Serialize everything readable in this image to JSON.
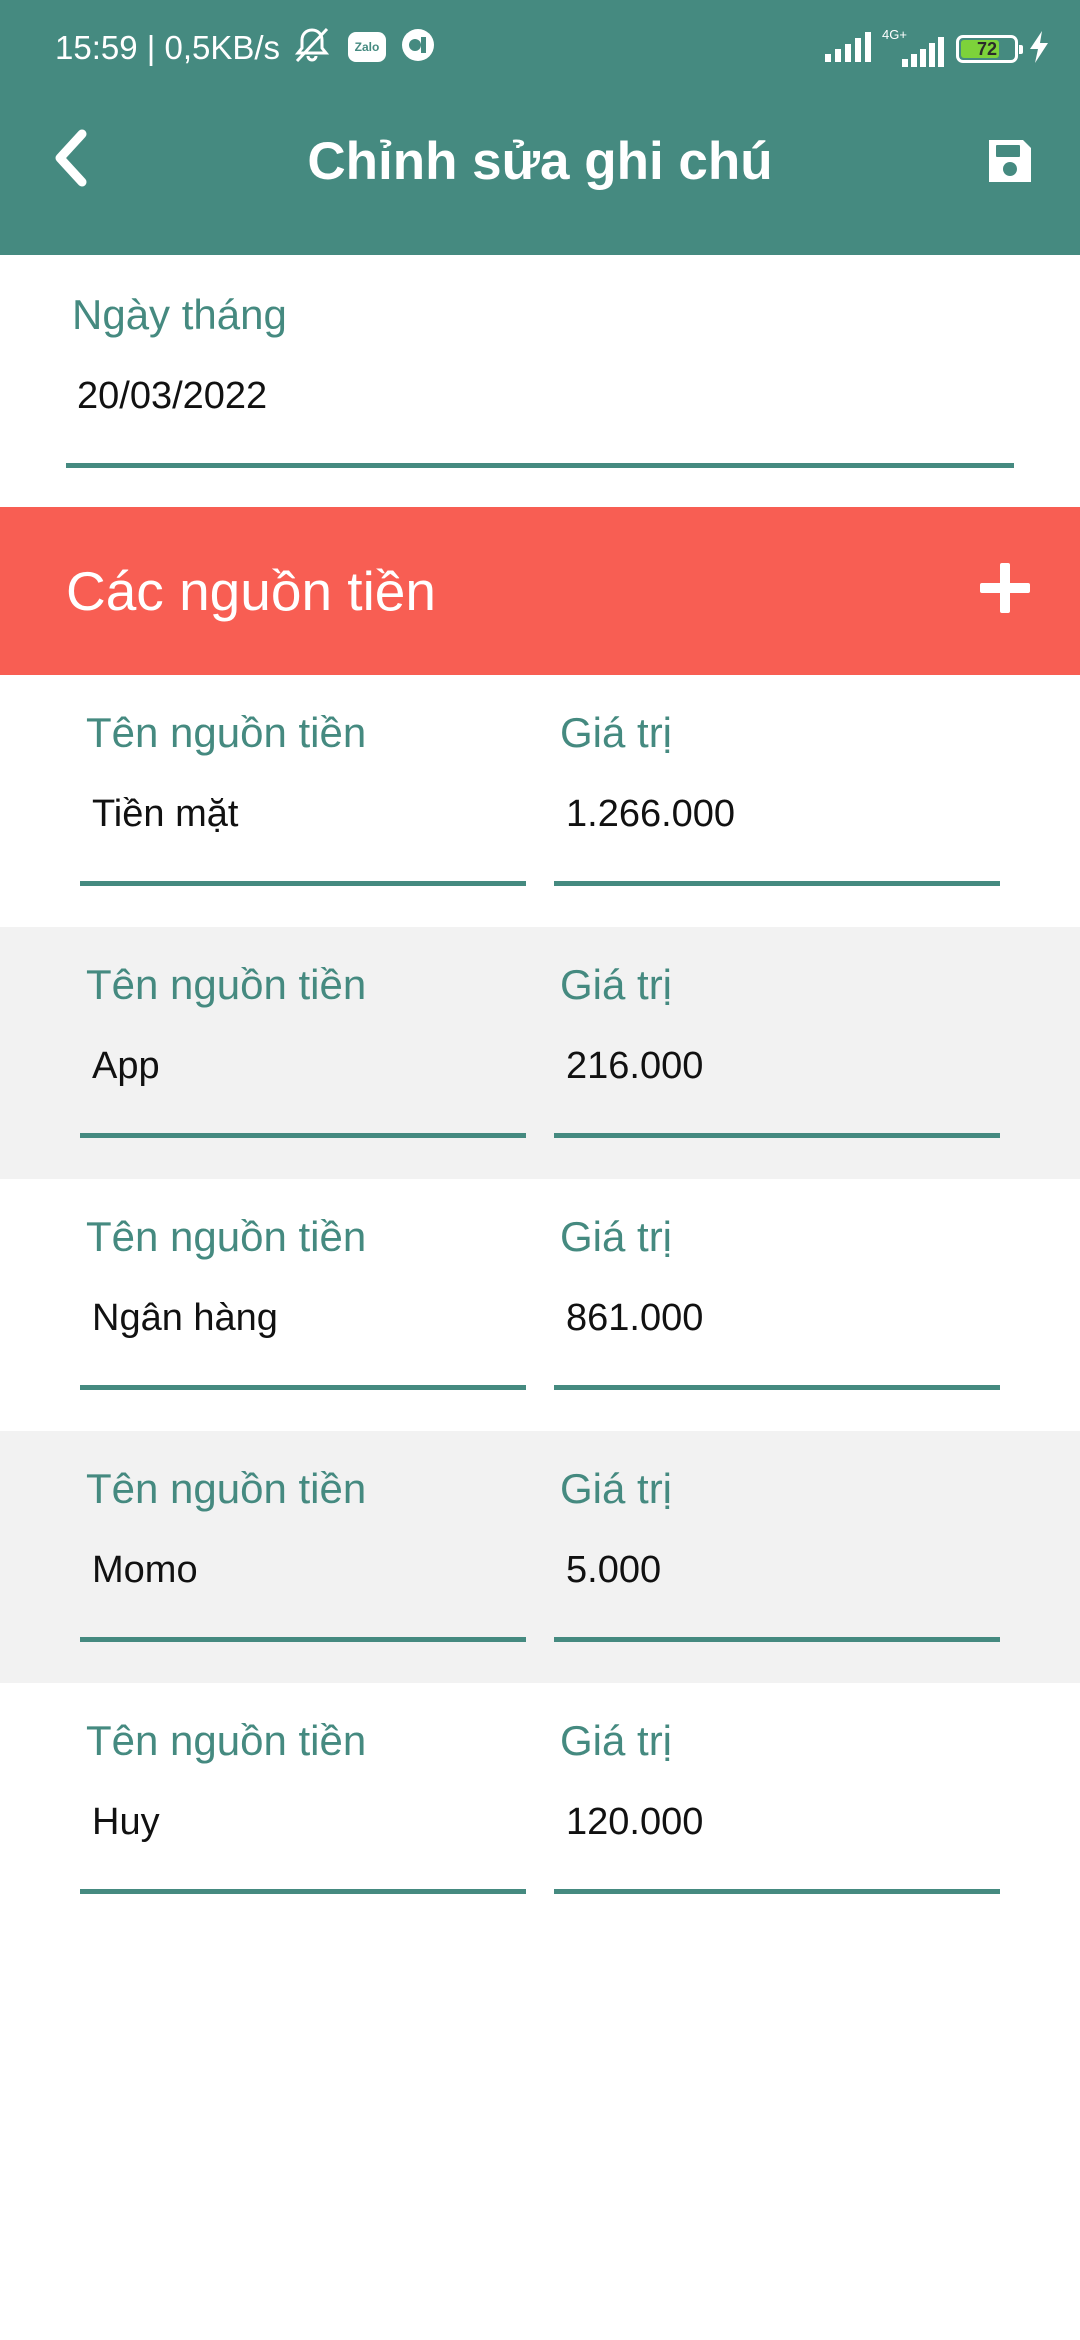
{
  "status_bar": {
    "time_speed": "15:59 | 0,5KB/s",
    "zalo": "Zalo",
    "network": "4G+",
    "battery": "72"
  },
  "app_bar": {
    "title": "Chỉnh sửa ghi chú",
    "back_icon": "chevron-left-icon",
    "save_icon": "floppy-disk-icon"
  },
  "date_field": {
    "label": "Ngày tháng",
    "value": "20/03/2022"
  },
  "sources": {
    "title": "Các nguồn tiền",
    "add_icon": "plus-icon",
    "name_label": "Tên nguồn tiền",
    "value_label": "Giá trị",
    "items": [
      {
        "name": "Tiền mặt",
        "value": "1.266.000"
      },
      {
        "name": "App",
        "value": "216.000"
      },
      {
        "name": "Ngân hàng",
        "value": "861.000"
      },
      {
        "name": "Momo",
        "value": "5.000"
      },
      {
        "name": "Huy",
        "value": "120.000"
      }
    ]
  },
  "colors": {
    "primary": "#458a80",
    "accent": "#f85e53",
    "row_alt": "#f2f2f2"
  }
}
